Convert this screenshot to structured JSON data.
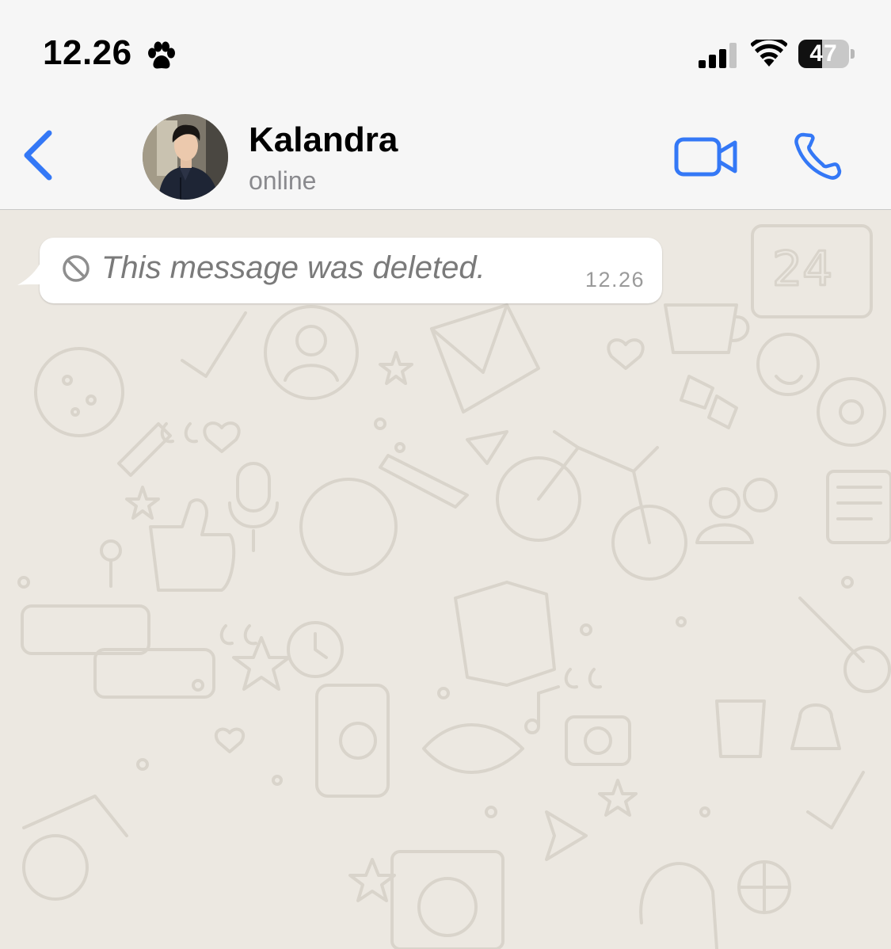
{
  "status_bar": {
    "time": "12.26",
    "paw_icon": "paw-icon",
    "battery_level": "47",
    "battery_percent": 47
  },
  "header": {
    "back_icon": "chevron-left-icon",
    "contact_name": "Kalandra",
    "contact_status": "online",
    "video_icon": "video-camera-icon",
    "call_icon": "phone-icon",
    "accent_color": "#3478f6"
  },
  "messages": [
    {
      "text": "This message was deleted.",
      "time": "12.26",
      "icon": "prohibited-icon",
      "deleted": true
    }
  ],
  "chat": {
    "wallpaper_color": "#ece8e1",
    "bubble_color": "#ffffff"
  }
}
